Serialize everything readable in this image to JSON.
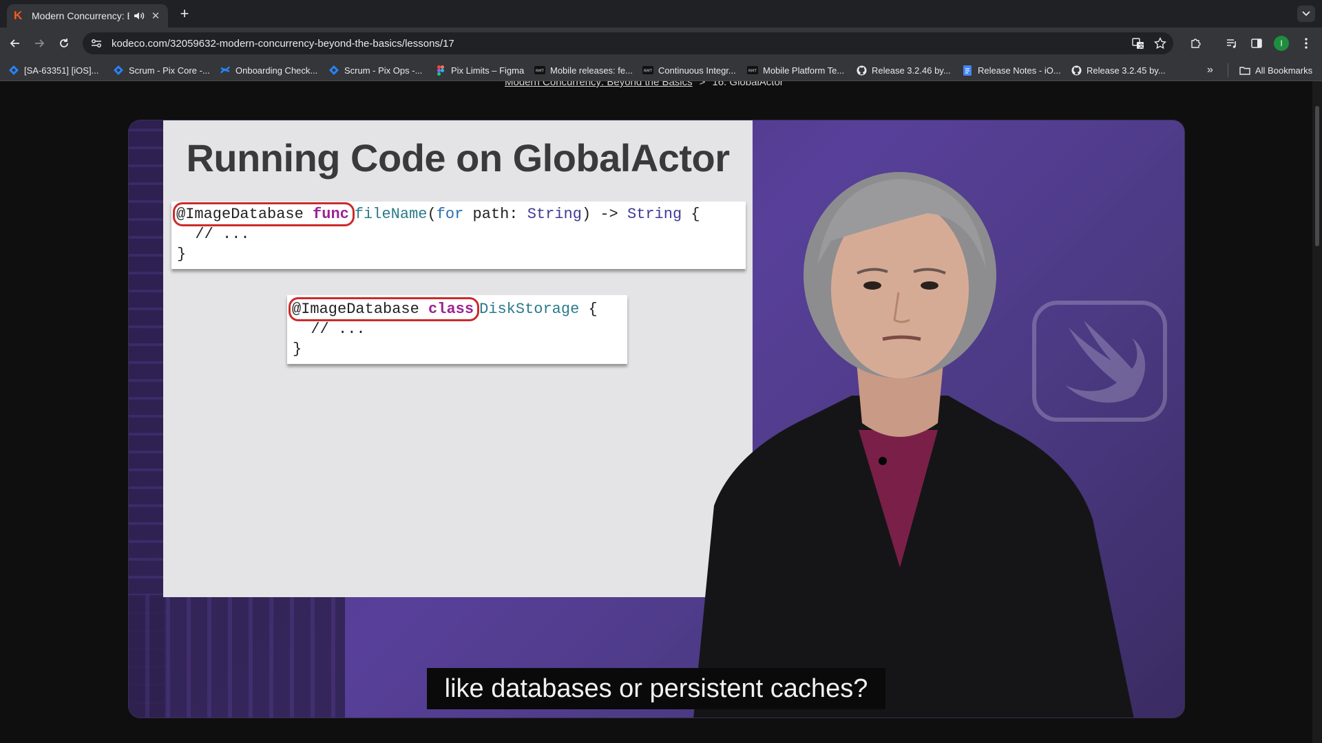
{
  "browser": {
    "tab": {
      "title": "Modern Concurrency: Beyond the Basics",
      "favicon": "K"
    },
    "url": "kodeco.com/32059632-modern-concurrency-beyond-the-basics/lessons/17",
    "avatar_letter": "I",
    "bookmarks": [
      {
        "label": "[SA-63351] [iOS]...",
        "icon": "jira-icon"
      },
      {
        "label": "Scrum - Pix Core -...",
        "icon": "jira-icon"
      },
      {
        "label": "Onboarding Check...",
        "icon": "confluence-icon"
      },
      {
        "label": "Scrum - Pix Ops -...",
        "icon": "jira-icon"
      },
      {
        "label": "Pix Limits – Figma",
        "icon": "figma-icon"
      },
      {
        "label": "Mobile releases: fe...",
        "icon": "rmt-icon"
      },
      {
        "label": "Continuous Integr...",
        "icon": "rmt-icon"
      },
      {
        "label": "Mobile Platform Te...",
        "icon": "rmt-icon"
      },
      {
        "label": "Release 3.2.46 by...",
        "icon": "github-icon"
      },
      {
        "label": "Release Notes - iO...",
        "icon": "docs-icon"
      },
      {
        "label": "Release 3.2.45 by...",
        "icon": "github-icon"
      }
    ],
    "overflow_label": "»",
    "all_bookmarks_label": "All Bookmarks"
  },
  "page": {
    "breadcrumb": {
      "course": "Modern Concurrency: Beyond the Basics",
      "separator": ">",
      "lesson": "16. GlobalActor"
    }
  },
  "video": {
    "slide_title": "Running Code on GlobalActor",
    "code1": {
      "annotation": "@ImageDatabase",
      "keyword": "func",
      "name": "fileName",
      "open_paren": "(",
      "param_kw": "for",
      "param": " path: ",
      "param_type": "String",
      "arrow": ") -> ",
      "return_type": "String",
      "brace": " {",
      "body": "  // ...",
      "close": "}"
    },
    "code2": {
      "annotation": "@ImageDatabase",
      "keyword": "class",
      "name": "DiskStorage",
      "brace": " {",
      "body": "  // ...",
      "close": "}"
    },
    "caption": "like databases or persistent caches?"
  }
}
